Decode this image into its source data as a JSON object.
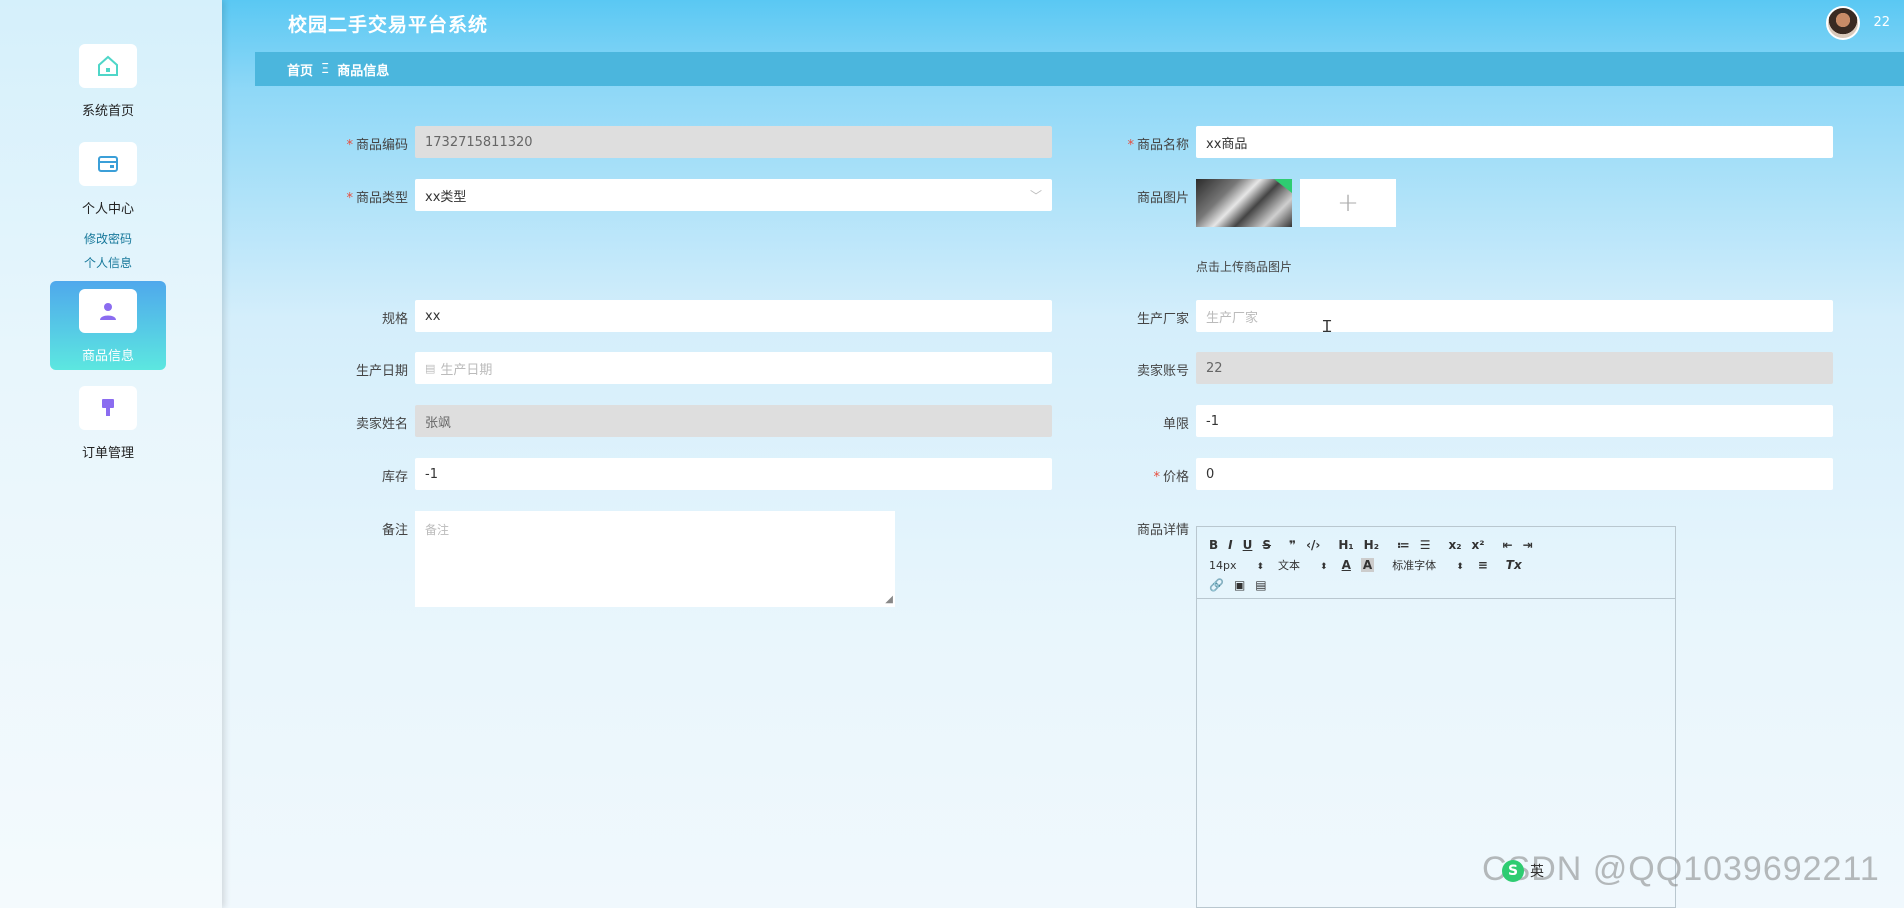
{
  "header": {
    "title": "校园二手交易平台系统",
    "username": "22"
  },
  "breadcrumb": {
    "home": "首页",
    "separator": "Ξ",
    "current": "商品信息"
  },
  "sidebar": {
    "items": [
      {
        "label": "系统首页",
        "icon": "home-icon"
      },
      {
        "label": "个人中心",
        "icon": "wallet-icon",
        "sub": [
          "修改密码",
          "个人信息"
        ]
      },
      {
        "label": "商品信息",
        "icon": "user-icon",
        "active": true
      },
      {
        "label": "订单管理",
        "icon": "brush-icon"
      }
    ]
  },
  "form": {
    "code_label": "商品编码",
    "code_value": "1732715811320",
    "name_label": "商品名称",
    "name_value": "xx商品",
    "type_label": "商品类型",
    "type_value": "xx类型",
    "image_label": "商品图片",
    "upload_plus": "+",
    "upload_hint": "点击上传商品图片",
    "spec_label": "规格",
    "spec_value": "xx",
    "maker_label": "生产厂家",
    "maker_placeholder": "生产厂家",
    "date_label": "生产日期",
    "date_placeholder": "生产日期",
    "seller_account_label": "卖家账号",
    "seller_account_value": "22",
    "seller_name_label": "卖家姓名",
    "seller_name_value": "张飒",
    "limit_label": "单限",
    "limit_value": "-1",
    "stock_label": "库存",
    "stock_value": "-1",
    "price_label": "价格",
    "price_value": "0",
    "remark_label": "备注",
    "remark_placeholder": "备注",
    "detail_label": "商品详情"
  },
  "editor": {
    "row1": [
      "B",
      "I",
      "U",
      "S",
      "❞",
      "‹/›",
      "H₁",
      "H₂",
      "≔",
      "☰",
      "x₂",
      "x²",
      "⇤",
      "⇥"
    ],
    "size": "14px",
    "block": "文本",
    "font": "标准字体",
    "align": "≡",
    "clear": "Tx"
  },
  "watermark": "CSDN @QQ1039692211",
  "ime": {
    "logo": "S",
    "lang": "英"
  }
}
